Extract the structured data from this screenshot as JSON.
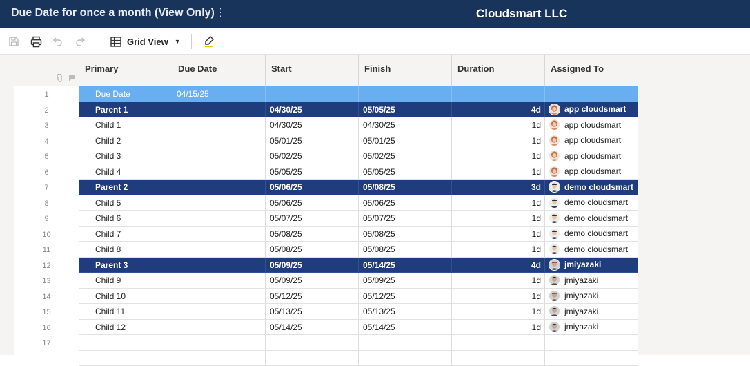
{
  "header": {
    "sheet_title": "Due Date for once a month (View Only)",
    "menu_glyph": "⋮",
    "org_name": "Cloudsmart LLC"
  },
  "toolbar": {
    "view_label": "Grid View",
    "view_caret": "▼",
    "icons": [
      "save-icon",
      "print-icon",
      "undo-icon",
      "redo-icon",
      "grid-view-icon",
      "highlight-icon"
    ]
  },
  "columns": {
    "primary": "Primary",
    "due_date": "Due Date",
    "start": "Start",
    "finish": "Finish",
    "duration": "Duration",
    "assigned": "Assigned To"
  },
  "colors": {
    "header_bg": "#18345a",
    "parent_row": "#1f3c7c",
    "due_row": "#6aaef2"
  },
  "rows": [
    {
      "num": "1",
      "style": "light",
      "primary": "Due Date",
      "due": "04/15/25",
      "start": "",
      "finish": "",
      "duration": "",
      "assigned": "",
      "avatar": ""
    },
    {
      "num": "2",
      "style": "parent",
      "primary": "Parent 1",
      "due": "",
      "start": "04/30/25",
      "finish": "05/05/25",
      "duration": "4d",
      "assigned": "app cloudsmart",
      "avatar": "female"
    },
    {
      "num": "3",
      "style": "normal",
      "primary": "Child 1",
      "due": "",
      "start": "04/30/25",
      "finish": "04/30/25",
      "duration": "1d",
      "assigned": "app cloudsmart",
      "avatar": "female"
    },
    {
      "num": "4",
      "style": "normal",
      "primary": "Child 2",
      "due": "",
      "start": "05/01/25",
      "finish": "05/01/25",
      "duration": "1d",
      "assigned": "app cloudsmart",
      "avatar": "female"
    },
    {
      "num": "5",
      "style": "normal",
      "primary": "Child 3",
      "due": "",
      "start": "05/02/25",
      "finish": "05/02/25",
      "duration": "1d",
      "assigned": "app cloudsmart",
      "avatar": "female"
    },
    {
      "num": "6",
      "style": "normal",
      "primary": "Child 4",
      "due": "",
      "start": "05/05/25",
      "finish": "05/05/25",
      "duration": "1d",
      "assigned": "app cloudsmart",
      "avatar": "female"
    },
    {
      "num": "7",
      "style": "parent",
      "primary": "Parent 2",
      "due": "",
      "start": "05/06/25",
      "finish": "05/08/25",
      "duration": "3d",
      "assigned": "demo cloudsmart",
      "avatar": "male"
    },
    {
      "num": "8",
      "style": "normal",
      "primary": "Child 5",
      "due": "",
      "start": "05/06/25",
      "finish": "05/06/25",
      "duration": "1d",
      "assigned": "demo cloudsmart",
      "avatar": "male"
    },
    {
      "num": "9",
      "style": "normal",
      "primary": "Child 6",
      "due": "",
      "start": "05/07/25",
      "finish": "05/07/25",
      "duration": "1d",
      "assigned": "demo cloudsmart",
      "avatar": "male"
    },
    {
      "num": "10",
      "style": "normal",
      "primary": "Child 7",
      "due": "",
      "start": "05/08/25",
      "finish": "05/08/25",
      "duration": "1d",
      "assigned": "demo cloudsmart",
      "avatar": "male"
    },
    {
      "num": "11",
      "style": "normal",
      "primary": "Child 8",
      "due": "",
      "start": "05/08/25",
      "finish": "05/08/25",
      "duration": "1d",
      "assigned": "demo cloudsmart",
      "avatar": "male"
    },
    {
      "num": "12",
      "style": "parent",
      "primary": "Parent 3",
      "due": "",
      "start": "05/09/25",
      "finish": "05/14/25",
      "duration": "4d",
      "assigned": "jmiyazaki",
      "avatar": "man"
    },
    {
      "num": "13",
      "style": "normal",
      "primary": "Child 9",
      "due": "",
      "start": "05/09/25",
      "finish": "05/09/25",
      "duration": "1d",
      "assigned": "jmiyazaki",
      "avatar": "man"
    },
    {
      "num": "14",
      "style": "normal",
      "primary": "Child 10",
      "due": "",
      "start": "05/12/25",
      "finish": "05/12/25",
      "duration": "1d",
      "assigned": "jmiyazaki",
      "avatar": "man"
    },
    {
      "num": "15",
      "style": "normal",
      "primary": "Child 11",
      "due": "",
      "start": "05/13/25",
      "finish": "05/13/25",
      "duration": "1d",
      "assigned": "jmiyazaki",
      "avatar": "man"
    },
    {
      "num": "16",
      "style": "normal",
      "primary": "Child 12",
      "due": "",
      "start": "05/14/25",
      "finish": "05/14/25",
      "duration": "1d",
      "assigned": "jmiyazaki",
      "avatar": "man"
    },
    {
      "num": "17",
      "style": "empty",
      "primary": "",
      "due": "",
      "start": "",
      "finish": "",
      "duration": "",
      "assigned": "",
      "avatar": ""
    },
    {
      "num": "",
      "style": "empty",
      "primary": "",
      "due": "",
      "start": "",
      "finish": "",
      "duration": "",
      "assigned": "",
      "avatar": ""
    }
  ]
}
